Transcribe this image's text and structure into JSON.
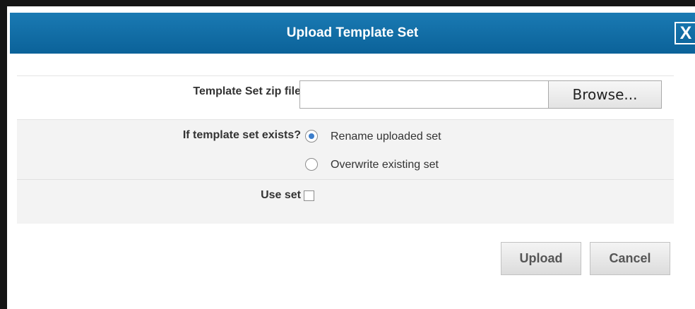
{
  "dialog": {
    "title": "Upload Template Set",
    "close_label": "X"
  },
  "form": {
    "zip_file": {
      "label": "Template Set zip file",
      "value": "",
      "browse_label": "Browse..."
    },
    "exists": {
      "label": "If template set exists?",
      "options": [
        {
          "label": "Rename uploaded set",
          "selected": true
        },
        {
          "label": "Overwrite existing set",
          "selected": false
        }
      ]
    },
    "use_set": {
      "label": "Use set",
      "checked": false
    }
  },
  "actions": {
    "upload_label": "Upload",
    "cancel_label": "Cancel"
  },
  "colors": {
    "titlebar": "#0b6299",
    "radio_selected": "#3d7ecb"
  }
}
